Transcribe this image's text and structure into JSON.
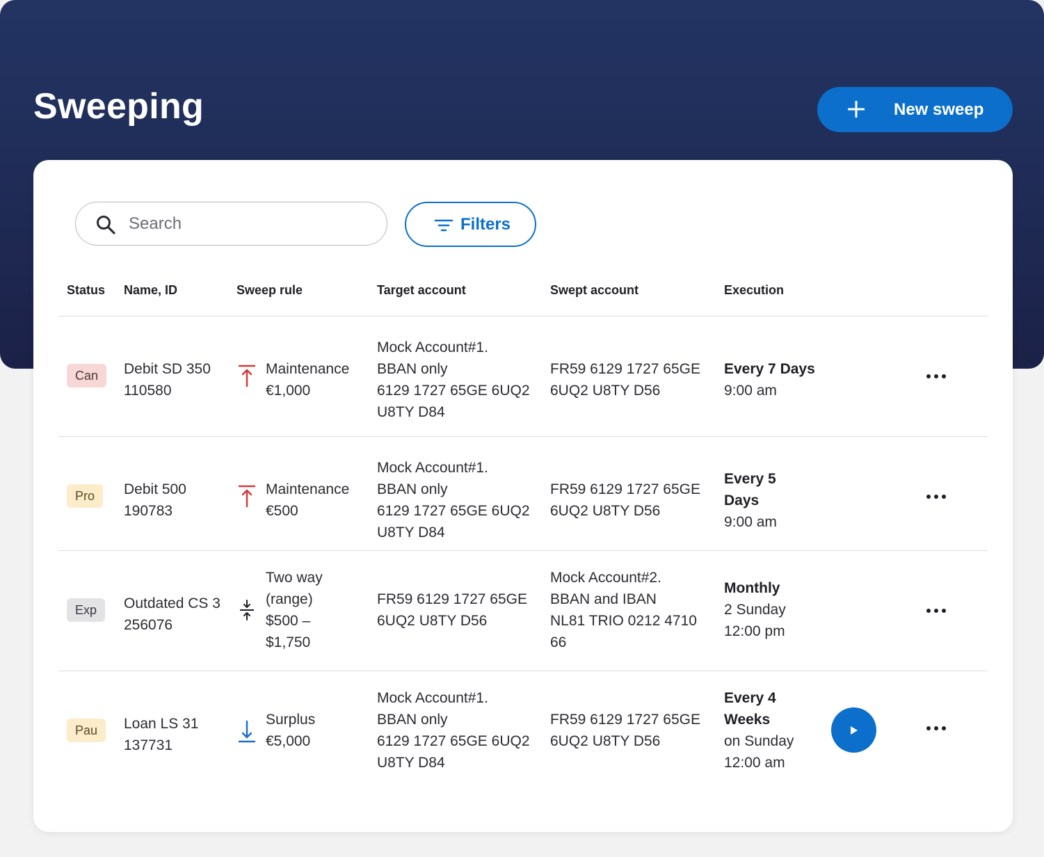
{
  "page": {
    "title": "Sweeping"
  },
  "header": {
    "new_sweep_label": "New sweep"
  },
  "toolbar": {
    "search_placeholder": "Search",
    "search_value": "",
    "filters_label": "Filters"
  },
  "table": {
    "columns": [
      "Status",
      "Name, ID",
      "Sweep rule",
      "Target account",
      "Swept account",
      "Execution"
    ],
    "rows": [
      {
        "status": "Can",
        "name": "Debit SD 350",
        "id": "110580",
        "rule_icon": "arrow-up-to-bar-icon",
        "rule": [
          "Maintenance",
          "€1,000"
        ],
        "target": [
          "Mock Account#1.",
          "BBAN only",
          "6129 1727 65GE 6UQ2",
          "U8TY D84"
        ],
        "swept": [
          "FR59 6129 1727 65GE",
          "6UQ2 U8TY D56"
        ],
        "exec_bold": [
          "Every 7 Days"
        ],
        "exec": [
          "9:00 am"
        ]
      },
      {
        "status": "Pro",
        "name": "Debit 500",
        "id": "190783",
        "rule_icon": "arrow-up-to-bar-icon",
        "rule": [
          "Maintenance",
          "€500"
        ],
        "target": [
          "Mock Account#1.",
          "BBAN only",
          "6129 1727 65GE 6UQ2",
          "U8TY D84"
        ],
        "swept": [
          "FR59 6129 1727 65GE",
          "6UQ2 U8TY D56"
        ],
        "exec_bold": [
          "Every 5",
          "Days"
        ],
        "exec": [
          "9:00 am"
        ]
      },
      {
        "status": "Exp",
        "name": "Outdated CS 3",
        "id": "256076",
        "rule_icon": "two-way-range-icon",
        "rule": [
          "Two way",
          "(range)",
          "$500 –",
          "$1,750"
        ],
        "target": [
          "FR59 6129 1727 65GE",
          "6UQ2 U8TY D56"
        ],
        "swept": [
          "Mock Account#2.",
          "BBAN and IBAN",
          "NL81 TRIO 0212 4710",
          "66"
        ],
        "exec_bold": [
          "Monthly"
        ],
        "exec": [
          "2 Sunday",
          "12:00 pm"
        ]
      },
      {
        "status": "Pau",
        "name": "Loan LS 31",
        "id": "137731",
        "rule_icon": "arrow-down-to-bar-icon",
        "rule": [
          "Surplus",
          "€5,000"
        ],
        "target": [
          "Mock Account#1.",
          "BBAN only",
          "6129 1727 65GE 6UQ2",
          "U8TY D84"
        ],
        "swept": [
          "FR59 6129 1727 65GE",
          "6UQ2 U8TY D56"
        ],
        "exec_bold": [
          "Every 4",
          "Weeks"
        ],
        "exec": [
          "on Sunday",
          "12:00 am"
        ]
      }
    ]
  },
  "icons": {
    "plus": "plus-icon",
    "search": "search-icon",
    "filter": "filter-icon",
    "more": "more-horizontal-icon",
    "play": "play-icon"
  },
  "colors": {
    "hero_bg": "#233463",
    "accent": "#0b6fcb",
    "status_cancelled": "#f8d7d7",
    "status_pending": "#fcecc9",
    "status_expired": "#e3e3e6",
    "rule_up": "#d43a3a",
    "rule_down": "#1c6fd0"
  }
}
